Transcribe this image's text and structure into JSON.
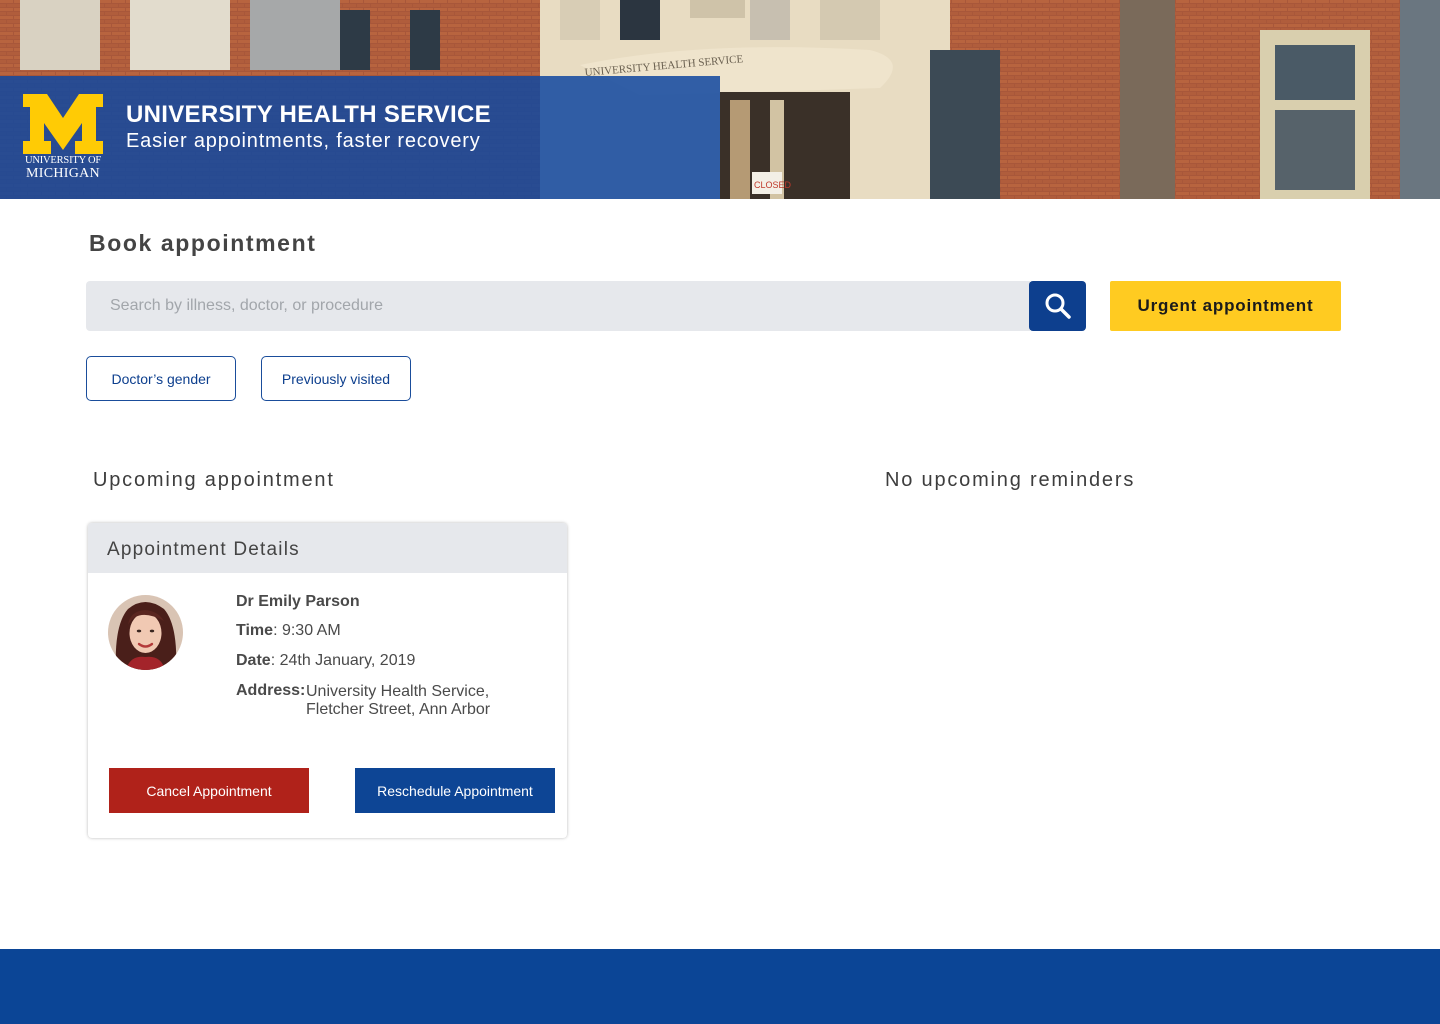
{
  "header": {
    "logo": {
      "line1": "UNIVERSITY OF",
      "line2": "MICHIGAN",
      "mark_color": "#FFCB05",
      "mark": "M"
    },
    "title": "UNIVERSITY HEALTH SERVICE",
    "tagline": "Easier appointments, faster recovery",
    "band_color": "#1248A0",
    "photo_sign": "UNIVERSITY HEALTH SERVICE",
    "photo_door_sign": "CLOSED"
  },
  "booking": {
    "title": "Book appointment",
    "search": {
      "placeholder": "Search by illness, doctor, or procedure",
      "value": "",
      "icon": "search-icon"
    },
    "urgent_label": "Urgent appointment",
    "filters": [
      {
        "label": "Doctor’s gender"
      },
      {
        "label": "Previously visited"
      }
    ]
  },
  "upcoming": {
    "title": "Upcoming appointment",
    "card": {
      "header": "Appointment Details",
      "doctor": "Dr Emily Parson",
      "time_label": "Time",
      "time": "9:30 AM",
      "date_label": "Date",
      "date": "24th January, 2019",
      "address_label": "Address",
      "address_line1": "University Health Service,",
      "address_line2": "Fletcher Street, Ann Arbor",
      "cancel_label": "Cancel Appointment",
      "reschedule_label": "Reschedule Appointment"
    }
  },
  "reminders": {
    "title": "No upcoming reminders"
  },
  "colors": {
    "primary": "#0D3F8E",
    "accent": "#FFCB21",
    "danger": "#B0221A",
    "footer": "#0B4596"
  }
}
